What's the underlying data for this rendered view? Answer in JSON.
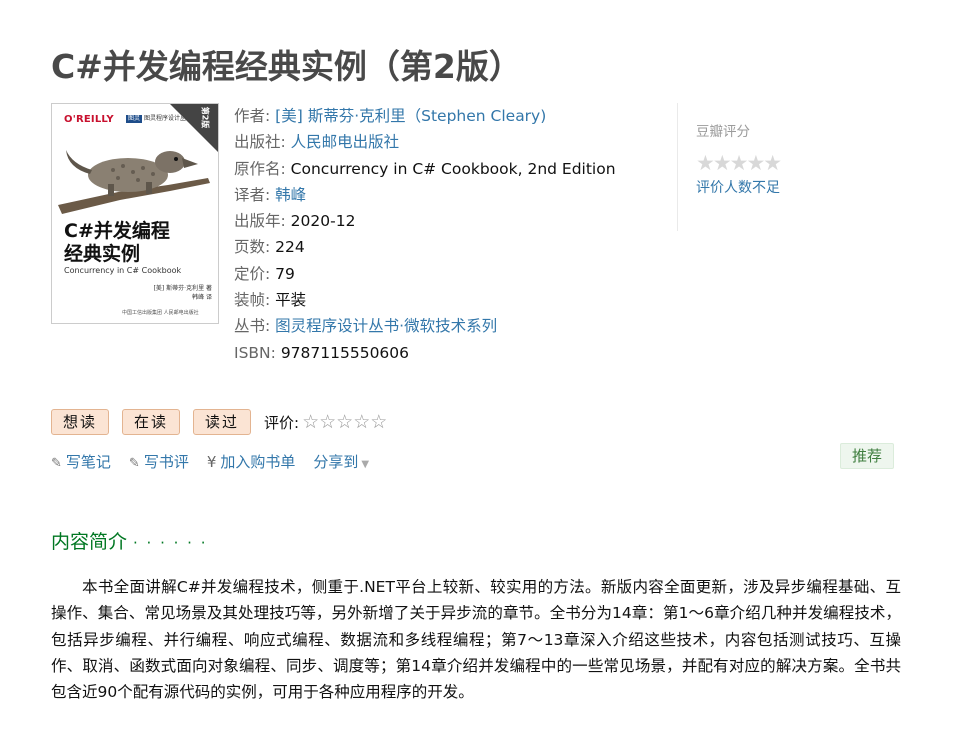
{
  "book": {
    "title": "C#并发编程经典实例（第2版）",
    "cover": {
      "publisher_logo": "O'REILLY",
      "series_badge": "图灵",
      "series_text": "图灵程序设计丛书",
      "edition_tag": "第2版",
      "title_line1": "C#并发编程",
      "title_line2": "经典实例",
      "subtitle": "Concurrency in C# Cookbook",
      "author_line1": "[美] 斯蒂芬·克利里 著",
      "author_line2": "韩峰 译",
      "footer": "中国工信出版集团 人民邮电出版社"
    },
    "info": {
      "author_label": "作者:",
      "author_value": "[美] 斯蒂芬·克利里（Stephen Cleary)",
      "publisher_label": "出版社:",
      "publisher_value": "人民邮电出版社",
      "original_title_label": "原作名:",
      "original_title_value": "Concurrency in C# Cookbook, 2nd Edition",
      "translator_label": "译者:",
      "translator_value": "韩峰",
      "pub_year_label": "出版年:",
      "pub_year_value": "2020-12",
      "pages_label": "页数:",
      "pages_value": "224",
      "price_label": "定价:",
      "price_value": "79",
      "binding_label": "装帧:",
      "binding_value": "平装",
      "series_label": "丛书:",
      "series_value": "图灵程序设计丛书·微软技术系列",
      "isbn_label": "ISBN:",
      "isbn_value": "9787115550606"
    }
  },
  "rating": {
    "label": "豆瓣评分",
    "stars": "★★★★★",
    "no_ratings": "评价人数不足"
  },
  "actions": {
    "want": "想读",
    "reading": "在读",
    "read": "读过",
    "rate_label": "评价:",
    "rate_stars": "☆☆☆☆☆"
  },
  "subactions": {
    "note": "写笔记",
    "review": "写书评",
    "cart_symbol": "¥",
    "cart": "加入购书单",
    "share": "分享到",
    "recommend": "推荐"
  },
  "intro": {
    "title": "内容简介",
    "dots": "· · · · · ·",
    "text": "本书全面讲解C#并发编程技术，侧重于.NET平台上较新、较实用的方法。新版内容全面更新，涉及异步编程基础、互操作、集合、常见场景及其处理技巧等，另外新增了关于异步流的章节。全书分为14章：第1～6章介绍几种并发编程技术，包括异步编程、并行编程、响应式编程、数据流和多线程编程；第7～13章深入介绍这些技术，内容包括测试技巧、互操作、取消、函数式面向对象编程、同步、调度等；第14章介绍并发编程中的一些常见场景，并配有对应的解决方案。全书共包含近90个配有源代码的实例，可用于各种应用程序的开发。"
  },
  "colors": {
    "link": "#3377aa",
    "section_title": "#007722",
    "button_bg": "#fbe4d4"
  }
}
